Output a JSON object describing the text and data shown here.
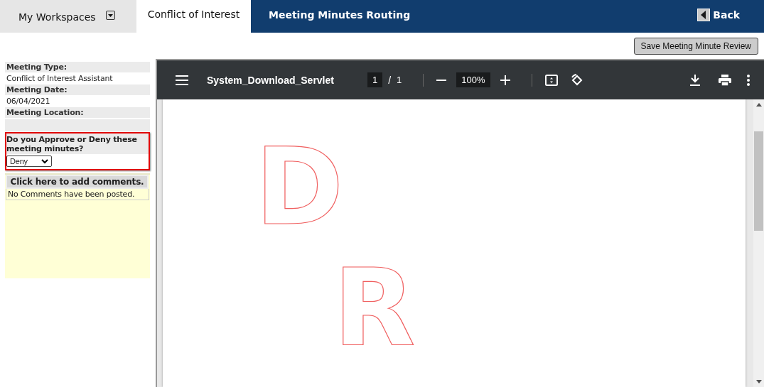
{
  "nav": {
    "tabs": [
      {
        "label": "My Workspaces",
        "selected": false,
        "kind": "menu"
      },
      {
        "label": "Conflict of Interest",
        "selected": true,
        "kind": "tab"
      }
    ],
    "page_title": "Meeting Minutes Routing",
    "back": "Back"
  },
  "save_button": "Save Meeting Minute Review",
  "details": [
    {
      "label": "Meeting Type:",
      "value": "Conflict of Interest Assistant"
    },
    {
      "label": "Meeting Date:",
      "value": "06/04/2021"
    },
    {
      "label": "Meeting Location:"
    }
  ],
  "approval": {
    "question": "Do you Approve or Deny these meeting minutes?",
    "value": "Deny",
    "highlighted": true
  },
  "comments": {
    "button": "Click here to add comments.",
    "message": "No Comments have been posted."
  },
  "viewer": {
    "title": "System_Download_Servlet",
    "page": "1",
    "separator": "/",
    "total": "1",
    "zoom": "100%",
    "watermark_letters": [
      "D",
      "R"
    ]
  }
}
